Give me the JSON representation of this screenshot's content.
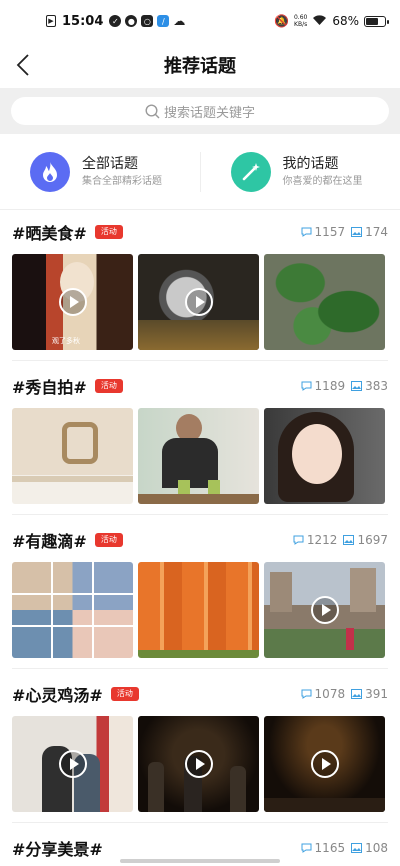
{
  "status_bar": {
    "time": "15:04",
    "net_speed_value": "0.60",
    "net_speed_unit": "KB/s",
    "battery": "68%",
    "battery_level": 0.68
  },
  "nav": {
    "title": "推荐话题",
    "back_icon": "chevron-left-icon"
  },
  "search": {
    "placeholder": "搜索话题关键字",
    "icon": "search-icon"
  },
  "entries": [
    {
      "title": "全部话题",
      "subtitle": "集合全部精彩话题",
      "icon": "flame-icon",
      "color": "#5b6cf3"
    },
    {
      "title": "我的话题",
      "subtitle": "你喜爱的都在这里",
      "icon": "magic-wand-icon",
      "color": "#2ec6a4"
    }
  ],
  "topics": [
    {
      "name": "#晒美食#",
      "badge": "活动",
      "comments": "1157",
      "images": "174"
    },
    {
      "name": "#秀自拍#",
      "badge": "活动",
      "comments": "1189",
      "images": "383"
    },
    {
      "name": "#有趣滴#",
      "badge": "活动",
      "comments": "1212",
      "images": "1697"
    },
    {
      "name": "#心灵鸡汤#",
      "badge": "活动",
      "comments": "1078",
      "images": "391"
    },
    {
      "name": "#分享美景#",
      "badge": "",
      "comments": "1165",
      "images": "108"
    }
  ],
  "thumb_caption": "观了多秋",
  "colors": {
    "badge": "#e8382e",
    "stat_icon": "#3fa0e0"
  }
}
